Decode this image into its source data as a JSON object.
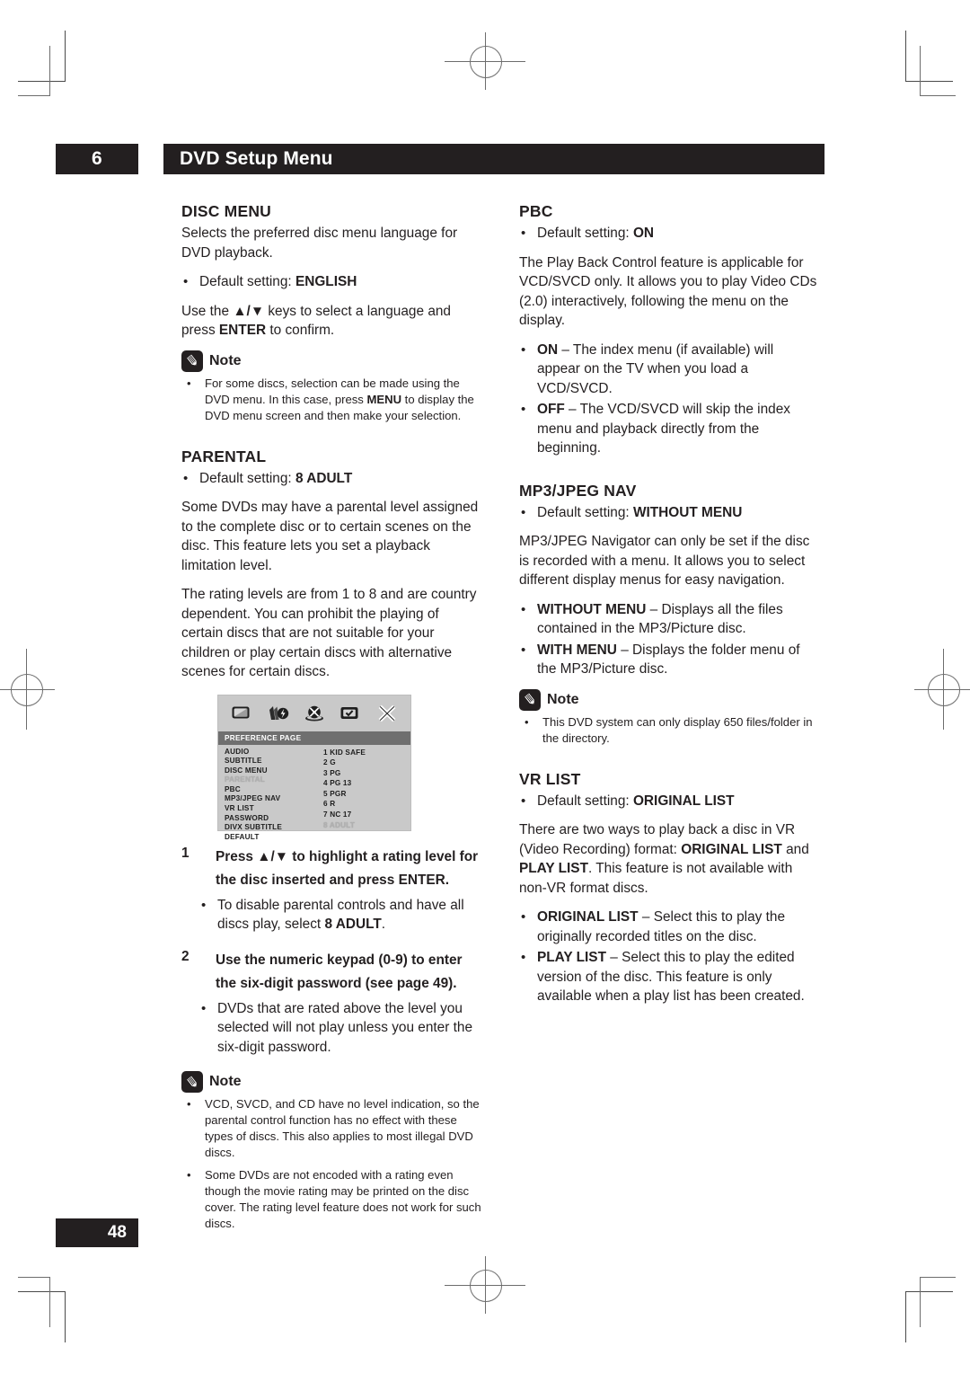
{
  "header": {
    "chapter_number": "6",
    "chapter_title": "DVD Setup Menu"
  },
  "page_number": "48",
  "left_column": {
    "disc_menu": {
      "heading": "DISC MENU",
      "intro": "Selects the preferred disc menu language for DVD playback.",
      "default_setting": "Default setting: ENGLISH",
      "default_label": "Default setting: ",
      "default_value": "ENGLISH",
      "instruction_1": "Use the ",
      "instruction_keys": "▲/▼",
      "instruction_2": " keys to select a language and press ",
      "instruction_key_enter": "ENTER",
      "instruction_3": " to confirm."
    },
    "note_1": {
      "label": "Note",
      "icon": "pencil-icon",
      "items": [
        {
          "part1": "For some discs, selection can be made using the DVD menu. In this case, press ",
          "bold": "MENU",
          "part2": " to display the DVD menu screen and then make your selection."
        }
      ]
    },
    "parental": {
      "heading": "PARENTAL",
      "default_label": "Default setting: ",
      "default_value": "8 ADULT",
      "para_1": "Some DVDs may have a parental level assigned to the complete disc or to certain scenes on the disc. This feature lets you set a playback limitation level.",
      "para_2": "The rating levels are from 1 to 8 and are country dependent. You can prohibit the playing of certain discs that are not suitable for your children or play certain discs with alternative scenes for certain discs."
    },
    "osd": {
      "title": "PREFERENCE PAGE",
      "icons": [
        "tv-screen-icon",
        "speaker-audio-icon",
        "disc-video-icon",
        "preference-screen-icon",
        "close-x-icon"
      ],
      "menu_items": [
        {
          "label": "AUDIO",
          "dim": false
        },
        {
          "label": "SUBTITLE",
          "dim": false
        },
        {
          "label": "DISC MENU",
          "dim": false
        },
        {
          "label": "PARENTAL",
          "dim": true
        },
        {
          "label": "PBC",
          "dim": false
        },
        {
          "label": "MP3/JPEG NAV",
          "dim": false
        },
        {
          "label": "VR LIST",
          "dim": false
        },
        {
          "label": "PASSWORD",
          "dim": false
        },
        {
          "label": "DIVX SUBTITLE",
          "dim": false
        },
        {
          "label": "DEFAULT",
          "dim": false
        }
      ],
      "rating_values": [
        {
          "label": "1 KID SAFE",
          "dim": false
        },
        {
          "label": "2 G",
          "dim": false
        },
        {
          "label": "3 PG",
          "dim": false
        },
        {
          "label": "4 PG 13",
          "dim": false
        },
        {
          "label": "5 PGR",
          "dim": false
        },
        {
          "label": "6 R",
          "dim": false
        },
        {
          "label": "7 NC 17",
          "dim": false
        },
        {
          "label": "8 ADULT",
          "dim": true
        }
      ]
    },
    "steps": [
      {
        "number": "1",
        "text_part1": "Press ",
        "keys": "▲/▼",
        "text_part2": " to highlight a rating level for the disc inserted and press ENTER.",
        "bullets": [
          {
            "part1": "To disable parental controls and have all discs play, select ",
            "bold": "8 ADULT",
            "part2": "."
          }
        ]
      },
      {
        "number": "2",
        "text_part1": "Use the numeric keypad (0-9) to enter the six-digit password (see page 49).",
        "keys": "",
        "text_part2": "",
        "bullets": [
          {
            "part1": "DVDs that are rated above the level you selected will not play unless you enter the six-digit password.",
            "bold": "",
            "part2": ""
          }
        ]
      }
    ],
    "note_2": {
      "label": "Note",
      "icon": "pencil-icon",
      "items": [
        {
          "part1": "VCD, SVCD, and CD have no level indication, so the parental control function has no effect with these types of discs. This also applies to most illegal DVD discs.",
          "bold": "",
          "part2": ""
        },
        {
          "part1": "Some DVDs are not encoded with a rating even though the movie rating may be printed on the disc cover. The rating level feature does not work for such discs.",
          "bold": "",
          "part2": ""
        }
      ]
    }
  },
  "right_column": {
    "pbc": {
      "heading": "PBC",
      "default_label": "Default setting: ",
      "default_value": "ON",
      "para_1": "The Play Back Control feature is applicable for VCD/SVCD only. It allows you to play Video CDs (2.0) interactively, following the menu on the display.",
      "bullets": [
        {
          "bold": "ON",
          "rest": " – The index menu (if available) will appear on the TV when you load a VCD/SVCD."
        },
        {
          "bold": "OFF",
          "rest": " – The VCD/SVCD will skip the index menu and playback directly from the beginning."
        }
      ]
    },
    "mp3_jpeg_nav": {
      "heading": "MP3/JPEG NAV",
      "default_label": "Default setting: ",
      "default_value": "WITHOUT MENU",
      "para_1": "MP3/JPEG Navigator can only be set if the disc is recorded with a menu. It allows you to select different display menus for easy navigation.",
      "bullets": [
        {
          "bold": "WITHOUT MENU",
          "rest": " – Displays all the files contained in the MP3/Picture disc."
        },
        {
          "bold": "WITH MENU",
          "rest": " – Displays the folder menu of the MP3/Picture disc."
        }
      ]
    },
    "note_3": {
      "label": "Note",
      "icon": "pencil-icon",
      "items": [
        {
          "part1": "This DVD system can only display 650 files/folder in the directory.",
          "bold": "",
          "part2": ""
        }
      ]
    },
    "vr_list": {
      "heading": "VR LIST",
      "default_label": "Default setting: ",
      "default_value": "ORIGINAL LIST",
      "para_1_a": "There are two ways to play back a disc in VR (Video Recording) format: ",
      "para_1_b": "ORIGINAL LIST",
      "para_1_c": " and ",
      "para_1_d": "PLAY LIST",
      "para_1_e": ". This feature is not available with non-VR format discs.",
      "bullets": [
        {
          "bold": "ORIGINAL LIST",
          "rest": " – Select this to play the originally recorded titles on the disc."
        },
        {
          "bold": "PLAY LIST",
          "rest": " – Select this to play the edited version of the disc. This feature is only available when a play list has been created."
        }
      ]
    }
  }
}
